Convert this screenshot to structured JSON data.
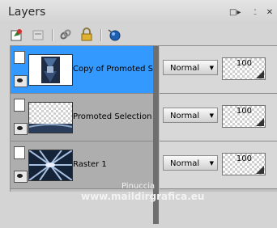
{
  "panel": {
    "title": "Layers"
  },
  "window_controls": {
    "dock": "□▸",
    "pin": "⍘",
    "close": "✕"
  },
  "toolbar": {
    "icons": [
      "new-layer-icon",
      "layer-properties-icon",
      "link-icon",
      "lock-icon",
      "circle-icon"
    ]
  },
  "layers": [
    {
      "name": "Copy of Promoted Sele",
      "blend": "Normal",
      "opacity": "100",
      "selected": true
    },
    {
      "name": "Promoted Selection",
      "blend": "Normal",
      "opacity": "100",
      "selected": false
    },
    {
      "name": "Raster 1",
      "blend": "Normal",
      "opacity": "100",
      "selected": false
    }
  ],
  "watermark": {
    "line1": "Pinuccia",
    "line2": "www.maildirgrafica.eu"
  },
  "colors": {
    "selection": "#3399ff",
    "panel_bg": "#c0c0c0"
  }
}
